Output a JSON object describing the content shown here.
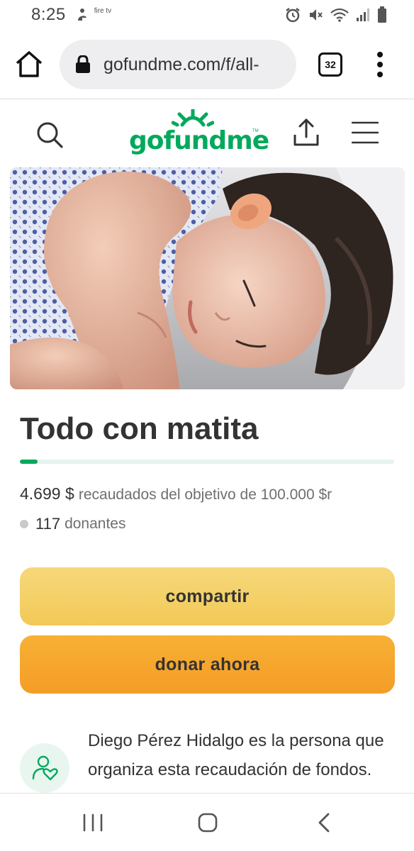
{
  "status_bar": {
    "time": "8:25",
    "firetv_label": "fire tv",
    "icons": [
      "accessibility-icon",
      "alarm-icon",
      "mute-icon",
      "wifi-icon",
      "signal-icon",
      "battery-icon"
    ]
  },
  "browser": {
    "url": "gofundme.com/f/all-",
    "tab_count": "32"
  },
  "site": {
    "logo": "gofundme",
    "logo_tm": "TM",
    "brand_color": "#02a95c"
  },
  "campaign": {
    "title": "Todo con matita",
    "raised_amount": "4.699 $",
    "raised_text": "recaudados del objetivo de 100.000 $r",
    "progress_percent": 4.7,
    "donors_count": "117",
    "donors_label": "donantes",
    "share_button": "compartir",
    "donate_button": "donar ahora",
    "organizer_text": "Diego Pérez Hidalgo es la persona que organiza esta recaudación de fondos."
  },
  "colors": {
    "share_button": "#f2c957",
    "donate_button": "#f49d26",
    "text": "#333333"
  }
}
